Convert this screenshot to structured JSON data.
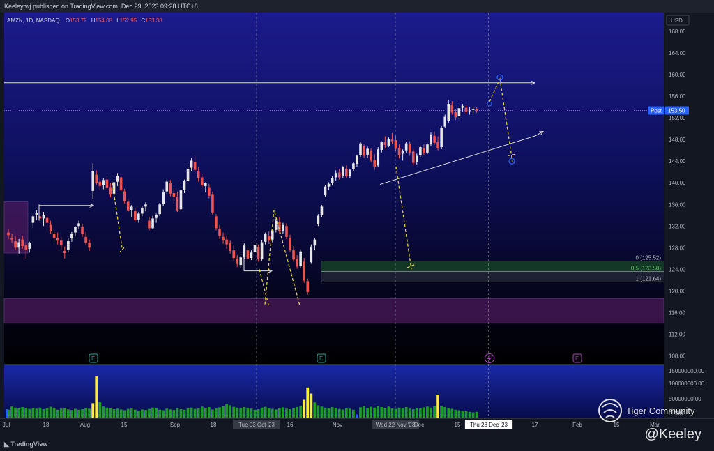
{
  "header": {
    "published": "Keeleytwj published on TradingView.com, Dec 29, 2023 09:28 UTC+8"
  },
  "legend": {
    "symbol": "AMZN, 1D, NASDAQ",
    "o_label": "O",
    "o_value": "153.72",
    "h_label": "H",
    "h_value": "154.08",
    "l_label": "L",
    "l_value": "152.95",
    "c_label": "C",
    "c_value": "153.38"
  },
  "currency": "USD",
  "post_label": "Post",
  "post_price": "153.50",
  "fib_labels": [
    "0 (125.52)",
    "0.5 (123.58)",
    "1 (121.64)"
  ],
  "watermark": "Tiger Community",
  "signature": "@Keeley",
  "footer_logo": "TradingView",
  "earnings_marker": "E",
  "colors": {
    "bull": "#e6e6e6",
    "bear": "#ef5350",
    "vol_green": "#1f9a2a",
    "vol_yellow": "#ffeb3b",
    "vol_blue": "#2962ff",
    "zigzag": "#e8d43c",
    "fib_green": "#2e7d32",
    "post_badge": "#2962ff"
  },
  "chart_data": {
    "type": "candlestick",
    "price_axis": {
      "ticks": [
        "168.00",
        "164.00",
        "160.00",
        "156.00",
        "152.00",
        "148.00",
        "144.00",
        "140.00",
        "136.00",
        "132.00",
        "128.00",
        "124.00",
        "120.00",
        "116.00",
        "112.00",
        "108.00"
      ],
      "range": [
        106.5,
        171.5
      ]
    },
    "volume_axis": {
      "ticks": [
        "150000000.00",
        "100000000.00",
        "50000000.00",
        "0.0000"
      ]
    },
    "time_axis": {
      "ticks": [
        "Jul",
        "18",
        "Aug",
        "15",
        "Sep",
        "18",
        "Tue 03 Oct '23",
        "16",
        "Nov",
        "Wed 22 Nov '23",
        "Dec",
        "15",
        "Thu 28 Dec '23",
        "17",
        "Feb",
        "15",
        "Mar"
      ]
    },
    "highlighted_dates": [
      "Tue 03 Oct '23",
      "Wed 22 Nov '23",
      "Thu 28 Dec '23"
    ],
    "ohlc": [
      [
        130.8,
        131.4,
        129.6,
        130.3
      ],
      [
        129.8,
        130.6,
        128.9,
        129.5
      ],
      [
        129.2,
        130.1,
        127.6,
        128.0
      ],
      [
        128.0,
        129.6,
        126.9,
        129.0
      ],
      [
        129.5,
        130.2,
        127.8,
        128.3
      ],
      [
        128.4,
        129.0,
        126.0,
        127.6
      ],
      [
        127.8,
        129.1,
        127.1,
        128.9
      ],
      [
        132.6,
        134.0,
        131.6,
        133.8
      ],
      [
        134.0,
        135.0,
        133.1,
        134.4
      ],
      [
        133.8,
        134.9,
        132.9,
        133.4
      ],
      [
        133.4,
        134.6,
        132.0,
        134.0
      ],
      [
        133.5,
        134.2,
        132.0,
        132.6
      ],
      [
        132.2,
        133.0,
        130.5,
        131.0
      ],
      [
        130.6,
        131.2,
        129.1,
        129.8
      ],
      [
        129.8,
        130.8,
        128.6,
        129.3
      ],
      [
        129.3,
        130.0,
        127.6,
        128.4
      ],
      [
        127.4,
        128.2,
        126.0,
        127.0
      ],
      [
        127.6,
        129.8,
        127.1,
        129.2
      ],
      [
        129.8,
        130.9,
        129.1,
        130.6
      ],
      [
        130.8,
        132.0,
        130.1,
        131.8
      ],
      [
        132.0,
        133.0,
        131.4,
        132.5
      ],
      [
        131.8,
        132.4,
        130.0,
        130.5
      ],
      [
        130.0,
        130.9,
        128.5,
        128.9
      ],
      [
        128.9,
        129.5,
        127.4,
        128.0
      ],
      [
        138.5,
        143.6,
        137.0,
        142.2
      ],
      [
        141.5,
        142.3,
        139.6,
        140.0
      ],
      [
        140.2,
        141.0,
        138.7,
        139.4
      ],
      [
        139.6,
        140.8,
        138.8,
        140.5
      ],
      [
        140.6,
        141.3,
        138.6,
        139.1
      ],
      [
        139.2,
        140.0,
        137.3,
        137.8
      ],
      [
        138.0,
        140.4,
        137.6,
        140.1
      ],
      [
        140.2,
        141.8,
        139.4,
        141.3
      ],
      [
        141.0,
        141.6,
        138.2,
        138.6
      ],
      [
        138.4,
        138.9,
        136.2,
        136.6
      ],
      [
        136.5,
        137.1,
        134.6,
        134.9
      ],
      [
        135.0,
        135.9,
        133.6,
        135.6
      ],
      [
        134.8,
        135.4,
        132.7,
        133.1
      ],
      [
        133.2,
        134.6,
        132.6,
        134.3
      ],
      [
        134.3,
        135.7,
        133.8,
        135.4
      ],
      [
        135.6,
        136.4,
        134.7,
        136.0
      ],
      [
        133.0,
        133.7,
        131.2,
        131.6
      ],
      [
        131.6,
        133.9,
        131.4,
        133.4
      ],
      [
        133.5,
        134.3,
        132.6,
        134.0
      ],
      [
        134.2,
        136.3,
        133.8,
        136.0
      ],
      [
        136.1,
        138.8,
        135.7,
        138.3
      ],
      [
        138.4,
        140.6,
        137.8,
        140.2
      ],
      [
        139.9,
        140.5,
        137.5,
        138.0
      ],
      [
        138.1,
        139.0,
        136.2,
        137.4
      ],
      [
        137.4,
        138.4,
        134.6,
        134.9
      ],
      [
        135.1,
        138.9,
        134.8,
        138.6
      ],
      [
        138.7,
        140.6,
        138.1,
        140.3
      ],
      [
        140.4,
        143.0,
        139.9,
        142.6
      ],
      [
        142.8,
        144.6,
        142.1,
        144.1
      ],
      [
        143.9,
        145.0,
        141.8,
        142.4
      ],
      [
        142.2,
        142.9,
        140.2,
        140.9
      ],
      [
        141.0,
        141.7,
        139.2,
        139.5
      ],
      [
        139.4,
        140.1,
        138.2,
        139.9
      ],
      [
        139.2,
        139.8,
        137.1,
        137.6
      ],
      [
        137.8,
        138.4,
        134.1,
        134.5
      ],
      [
        133.8,
        134.2,
        131.2,
        131.6
      ],
      [
        131.5,
        132.2,
        129.6,
        130.2
      ],
      [
        130.0,
        130.8,
        128.7,
        129.4
      ],
      [
        129.5,
        130.2,
        127.8,
        128.6
      ],
      [
        128.8,
        129.3,
        126.9,
        127.4
      ],
      [
        127.5,
        128.4,
        125.6,
        126.1
      ],
      [
        126.0,
        126.6,
        124.4,
        125.0
      ],
      [
        124.8,
        126.5,
        124.3,
        126.2
      ],
      [
        126.2,
        128.8,
        125.8,
        128.4
      ],
      [
        127.5,
        127.9,
        125.6,
        126.0
      ],
      [
        126.1,
        127.5,
        125.7,
        127.1
      ],
      [
        127.2,
        128.8,
        126.8,
        128.5
      ],
      [
        128.1,
        128.6,
        125.4,
        125.9
      ],
      [
        125.9,
        129.4,
        125.6,
        129.0
      ],
      [
        129.1,
        130.8,
        128.6,
        130.5
      ],
      [
        130.2,
        131.0,
        128.7,
        129.3
      ],
      [
        129.5,
        131.4,
        129.0,
        131.2
      ],
      [
        131.3,
        133.4,
        130.8,
        133.0
      ],
      [
        132.8,
        133.6,
        130.6,
        131.0
      ],
      [
        131.1,
        132.6,
        130.5,
        132.2
      ],
      [
        132.0,
        132.5,
        129.6,
        130.0
      ],
      [
        129.8,
        130.4,
        127.2,
        127.6
      ],
      [
        127.5,
        128.3,
        125.4,
        125.8
      ],
      [
        125.9,
        126.6,
        124.1,
        124.5
      ],
      [
        124.6,
        127.7,
        124.2,
        127.3
      ],
      [
        125.4,
        126.1,
        121.5,
        121.9
      ],
      [
        121.8,
        122.3,
        119.3,
        119.8
      ],
      [
        125.3,
        128.6,
        125.0,
        128.2
      ],
      [
        128.4,
        129.8,
        127.5,
        129.5
      ],
      [
        132.3,
        134.2,
        132.0,
        133.9
      ],
      [
        134.0,
        135.9,
        133.6,
        135.6
      ],
      [
        137.7,
        139.6,
        137.4,
        139.3
      ],
      [
        139.3,
        140.1,
        138.7,
        139.8
      ],
      [
        139.9,
        141.2,
        139.5,
        140.9
      ],
      [
        141.0,
        142.3,
        140.4,
        141.8
      ],
      [
        141.9,
        142.6,
        140.6,
        141.0
      ],
      [
        141.2,
        143.1,
        140.9,
        142.9
      ],
      [
        142.6,
        143.2,
        140.9,
        141.2
      ],
      [
        141.3,
        142.6,
        140.8,
        142.4
      ],
      [
        142.5,
        143.8,
        142.1,
        143.6
      ],
      [
        143.5,
        145.2,
        143.0,
        145.0
      ],
      [
        145.1,
        147.6,
        144.8,
        147.3
      ],
      [
        146.8,
        147.1,
        144.6,
        145.0
      ],
      [
        145.2,
        146.7,
        144.6,
        146.3
      ],
      [
        146.0,
        146.4,
        143.8,
        144.1
      ],
      [
        144.2,
        145.3,
        142.4,
        143.0
      ],
      [
        143.2,
        146.6,
        142.9,
        146.2
      ],
      [
        146.1,
        147.7,
        145.6,
        147.5
      ],
      [
        147.5,
        148.6,
        146.4,
        147.0
      ],
      [
        146.8,
        148.4,
        146.6,
        148.1
      ],
      [
        148.0,
        149.2,
        147.2,
        147.7
      ],
      [
        147.9,
        148.7,
        145.9,
        146.3
      ],
      [
        146.5,
        147.1,
        144.5,
        145.1
      ],
      [
        145.4,
        146.2,
        144.1,
        145.9
      ],
      [
        146.0,
        147.6,
        145.6,
        147.3
      ],
      [
        147.2,
        147.7,
        145.0,
        145.6
      ],
      [
        145.8,
        146.2,
        143.2,
        143.7
      ],
      [
        143.9,
        145.4,
        143.4,
        145.0
      ],
      [
        145.1,
        146.9,
        144.8,
        146.6
      ],
      [
        146.4,
        147.1,
        145.1,
        145.5
      ],
      [
        145.6,
        147.3,
        145.3,
        147.1
      ],
      [
        147.2,
        149.3,
        146.8,
        148.8
      ],
      [
        148.7,
        149.5,
        147.0,
        147.4
      ],
      [
        147.5,
        148.6,
        146.0,
        146.4
      ],
      [
        146.6,
        150.5,
        146.2,
        150.2
      ],
      [
        150.4,
        152.6,
        150.1,
        152.2
      ],
      [
        151.5,
        155.3,
        151.1,
        154.6
      ],
      [
        154.5,
        155.1,
        152.6,
        153.0
      ],
      [
        153.1,
        153.7,
        151.6,
        152.1
      ],
      [
        152.3,
        154.1,
        151.9,
        153.8
      ],
      [
        153.9,
        154.6,
        153.2,
        154.2
      ],
      [
        153.9,
        154.3,
        152.8,
        153.2
      ],
      [
        153.3,
        154.0,
        152.6,
        153.4
      ],
      [
        153.5,
        154.1,
        152.9,
        153.6
      ],
      [
        153.72,
        154.08,
        152.95,
        153.38
      ]
    ],
    "volume": [
      [
        30,
        "g"
      ],
      [
        42,
        "g"
      ],
      [
        38,
        "g"
      ],
      [
        35,
        "g"
      ],
      [
        40,
        "g"
      ],
      [
        37,
        "g"
      ],
      [
        33,
        "g"
      ],
      [
        36,
        "g"
      ],
      [
        34,
        "g"
      ],
      [
        38,
        "g"
      ],
      [
        32,
        "g"
      ],
      [
        35,
        "g"
      ],
      [
        41,
        "g"
      ],
      [
        36,
        "g"
      ],
      [
        30,
        "g"
      ],
      [
        34,
        "g"
      ],
      [
        37,
        "g"
      ],
      [
        31,
        "g"
      ],
      [
        29,
        "g"
      ],
      [
        33,
        "g"
      ],
      [
        30,
        "g"
      ],
      [
        32,
        "g"
      ],
      [
        36,
        "g"
      ],
      [
        34,
        "g"
      ],
      [
        55,
        "y"
      ],
      [
        160,
        "y"
      ],
      [
        60,
        "g"
      ],
      [
        42,
        "g"
      ],
      [
        38,
        "g"
      ],
      [
        35,
        "g"
      ],
      [
        32,
        "g"
      ],
      [
        34,
        "g"
      ],
      [
        31,
        "g"
      ],
      [
        28,
        "g"
      ],
      [
        33,
        "g"
      ],
      [
        36,
        "g"
      ],
      [
        30,
        "g"
      ],
      [
        27,
        "g"
      ],
      [
        31,
        "g"
      ],
      [
        29,
        "g"
      ],
      [
        33,
        "g"
      ],
      [
        38,
        "g"
      ],
      [
        35,
        "g"
      ],
      [
        30,
        "g"
      ],
      [
        28,
        "g"
      ],
      [
        34,
        "g"
      ],
      [
        31,
        "g"
      ],
      [
        29,
        "g"
      ],
      [
        36,
        "g"
      ],
      [
        32,
        "g"
      ],
      [
        30,
        "g"
      ],
      [
        35,
        "g"
      ],
      [
        38,
        "g"
      ],
      [
        33,
        "g"
      ],
      [
        36,
        "g"
      ],
      [
        42,
        "g"
      ],
      [
        37,
        "g"
      ],
      [
        40,
        "g"
      ],
      [
        31,
        "g"
      ],
      [
        35,
        "g"
      ],
      [
        39,
        "g"
      ],
      [
        44,
        "g"
      ],
      [
        52,
        "g"
      ],
      [
        47,
        "g"
      ],
      [
        41,
        "g"
      ],
      [
        38,
        "g"
      ],
      [
        36,
        "g"
      ],
      [
        40,
        "g"
      ],
      [
        37,
        "g"
      ],
      [
        34,
        "g"
      ],
      [
        30,
        "g"
      ],
      [
        32,
        "g"
      ],
      [
        38,
        "g"
      ],
      [
        41,
        "g"
      ],
      [
        36,
        "g"
      ],
      [
        33,
        "g"
      ],
      [
        31,
        "g"
      ],
      [
        35,
        "g"
      ],
      [
        39,
        "g"
      ],
      [
        34,
        "g"
      ],
      [
        32,
        "g"
      ],
      [
        36,
        "g"
      ],
      [
        40,
        "g"
      ],
      [
        45,
        "g"
      ],
      [
        68,
        "y"
      ],
      [
        115,
        "y"
      ],
      [
        92,
        "y"
      ],
      [
        58,
        "g"
      ],
      [
        47,
        "g"
      ],
      [
        42,
        "g"
      ],
      [
        38,
        "g"
      ],
      [
        35,
        "g"
      ],
      [
        40,
        "g"
      ],
      [
        37,
        "g"
      ],
      [
        33,
        "g"
      ],
      [
        31,
        "g"
      ],
      [
        36,
        "g"
      ],
      [
        34,
        "g"
      ],
      [
        30,
        "g"
      ],
      [
        12,
        "b"
      ],
      [
        39,
        "g"
      ],
      [
        44,
        "g"
      ],
      [
        36,
        "g"
      ],
      [
        41,
        "g"
      ],
      [
        38,
        "g"
      ],
      [
        45,
        "g"
      ],
      [
        40,
        "g"
      ],
      [
        37,
        "g"
      ],
      [
        42,
        "g"
      ],
      [
        35,
        "g"
      ],
      [
        33,
        "g"
      ],
      [
        38,
        "g"
      ],
      [
        36,
        "g"
      ],
      [
        40,
        "g"
      ],
      [
        34,
        "g"
      ],
      [
        32,
        "g"
      ],
      [
        37,
        "g"
      ],
      [
        35,
        "g"
      ],
      [
        39,
        "g"
      ],
      [
        42,
        "g"
      ],
      [
        38,
        "g"
      ],
      [
        44,
        "g"
      ],
      [
        88,
        "y"
      ],
      [
        45,
        "g"
      ],
      [
        40,
        "g"
      ],
      [
        36,
        "g"
      ],
      [
        33,
        "g"
      ],
      [
        30,
        "g"
      ],
      [
        28,
        "g"
      ],
      [
        26,
        "g"
      ],
      [
        24,
        "g"
      ],
      [
        22,
        "g"
      ],
      [
        20,
        "g"
      ],
      [
        22,
        "g"
      ]
    ],
    "horizontal_ray_price": 158.5,
    "fib_levels": [
      125.52,
      123.58,
      121.64
    ],
    "last_close": 153.38,
    "zones": [
      {
        "name": "purple-left-zone",
        "from_price": 127.0,
        "to_price": 136.5
      },
      {
        "name": "purple-bottom-zone",
        "from_price": 114.0,
        "to_price": 118.6
      }
    ]
  }
}
